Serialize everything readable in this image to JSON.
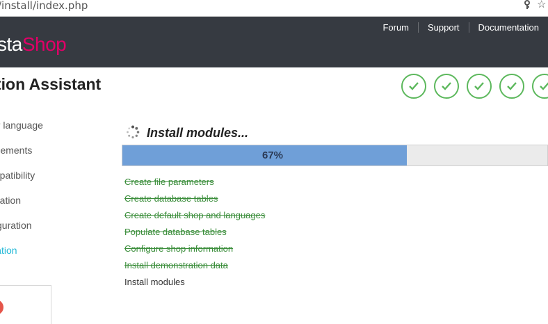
{
  "browser": {
    "url": "/install/index.php",
    "icons": [
      "key-icon",
      "star-icon"
    ]
  },
  "header": {
    "logo_part1": "sta",
    "logo_part2": "Shop",
    "nav": [
      "Forum",
      "Support",
      "Documentation"
    ],
    "colors": {
      "background": "#363a41",
      "brand": "#df0067"
    }
  },
  "page": {
    "title": "tion Assistant",
    "completed_steps": 5
  },
  "sidebar": {
    "items": [
      {
        "label": "ur language",
        "active": false
      },
      {
        "label": "reements",
        "active": false
      },
      {
        "label": "mpatibility",
        "active": false
      },
      {
        "label": "mation",
        "active": false
      },
      {
        "label": "figuration",
        "active": false
      },
      {
        "label": "llation",
        "active": true
      }
    ]
  },
  "main": {
    "title": "Install modules...",
    "progress": {
      "value": 0.67,
      "label": "67%"
    },
    "tasks": [
      {
        "label": "Create file parameters",
        "done": true
      },
      {
        "label": "Create database tables",
        "done": true
      },
      {
        "label": "Create default shop and languages",
        "done": true
      },
      {
        "label": "Populate database tables",
        "done": true
      },
      {
        "label": "Configure shop information",
        "done": true
      },
      {
        "label": "Install demonstration data",
        "done": true
      },
      {
        "label": "Install modules",
        "done": false
      }
    ]
  }
}
